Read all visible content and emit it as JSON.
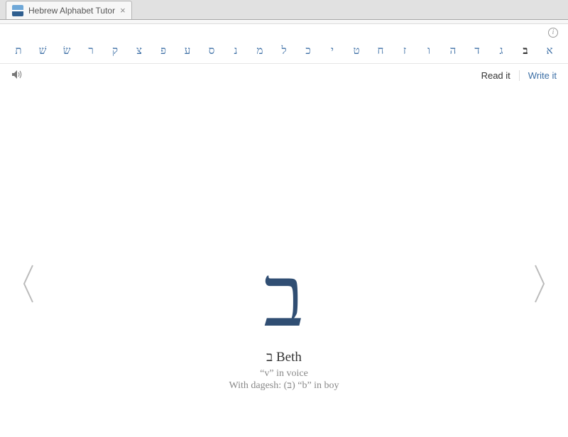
{
  "tab": {
    "title": "Hebrew Alphabet Tutor"
  },
  "alphabet": {
    "letters": [
      "א",
      "ב",
      "ג",
      "ד",
      "ה",
      "ו",
      "ז",
      "ח",
      "ט",
      "י",
      "כ",
      "ל",
      "מ",
      "נ",
      "ס",
      "ע",
      "פ",
      "צ",
      "ק",
      "ר",
      "שׂ",
      "שׁ",
      "ת"
    ],
    "current_index": 1
  },
  "modes": {
    "read": "Read it",
    "write": "Write it"
  },
  "card": {
    "letter": "ב",
    "name_hebrew": "ב",
    "name_latin": "Beth",
    "pron1": "“v” in voice",
    "pron2": "With dagesh: (בּ) “b” in boy"
  },
  "icons": {
    "info": "i",
    "speaker": "speaker",
    "prev": "prev",
    "next": "next",
    "close": "×"
  }
}
